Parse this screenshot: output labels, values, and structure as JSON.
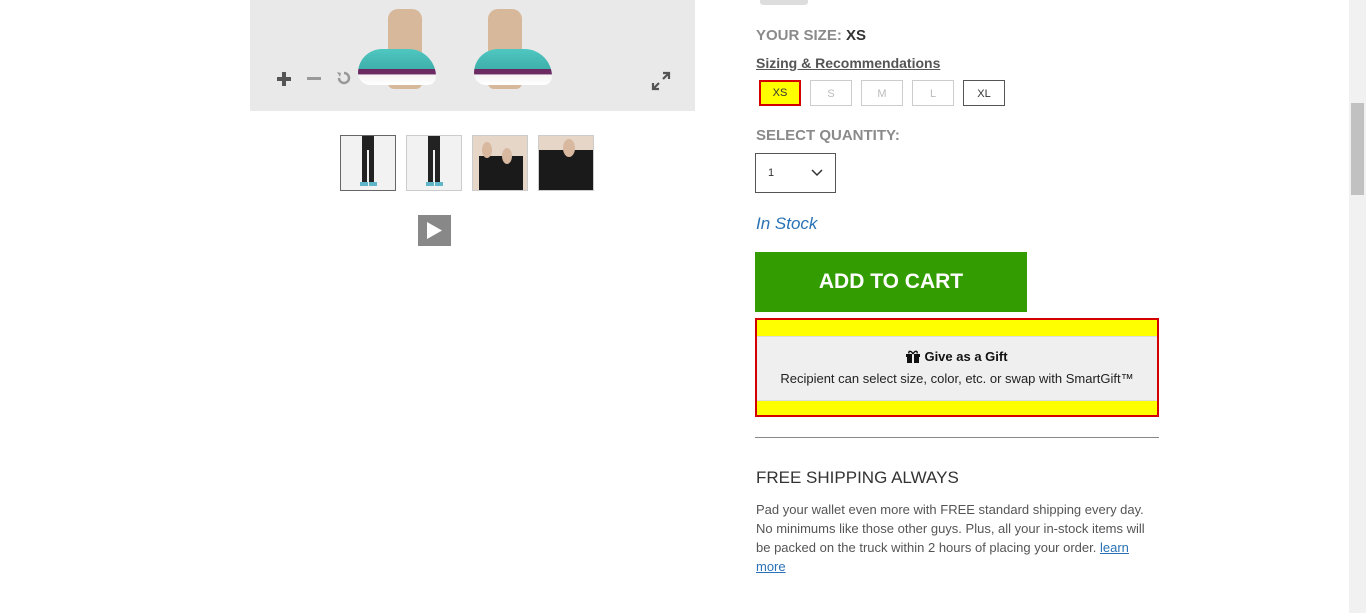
{
  "gallery": {
    "zoom_in_icon": "plus-icon",
    "zoom_out_icon": "minus-icon",
    "reset_icon": "rotate-icon",
    "expand_icon": "expand-icon",
    "play_icon": "play-icon"
  },
  "product": {
    "your_size_label": "YOUR SIZE:",
    "your_size_value": "XS",
    "sizing_link": "Sizing & Recommendations",
    "sizes": [
      "XS",
      "S",
      "M",
      "L",
      "XL"
    ],
    "selected_size": "XS",
    "quantity_label": "SELECT QUANTITY:",
    "quantity_value": "1",
    "stock_status": "In Stock",
    "add_to_cart": "ADD TO CART"
  },
  "gift": {
    "title": "Give as a Gift",
    "subtitle": "Recipient can select size, color, etc. or swap with SmartGift™"
  },
  "shipping": {
    "title": "FREE SHIPPING ALWAYS",
    "text": "Pad your wallet even more with FREE standard shipping every day. No minimums like those other guys. Plus, all your in-stock items will be packed on the truck within 2 hours of placing your order.",
    "link": "learn more"
  },
  "colors": {
    "cart_green": "#329c00",
    "highlight_yellow": "#ffff00",
    "highlight_red": "#d40000",
    "link_blue": "#2a72b5"
  }
}
